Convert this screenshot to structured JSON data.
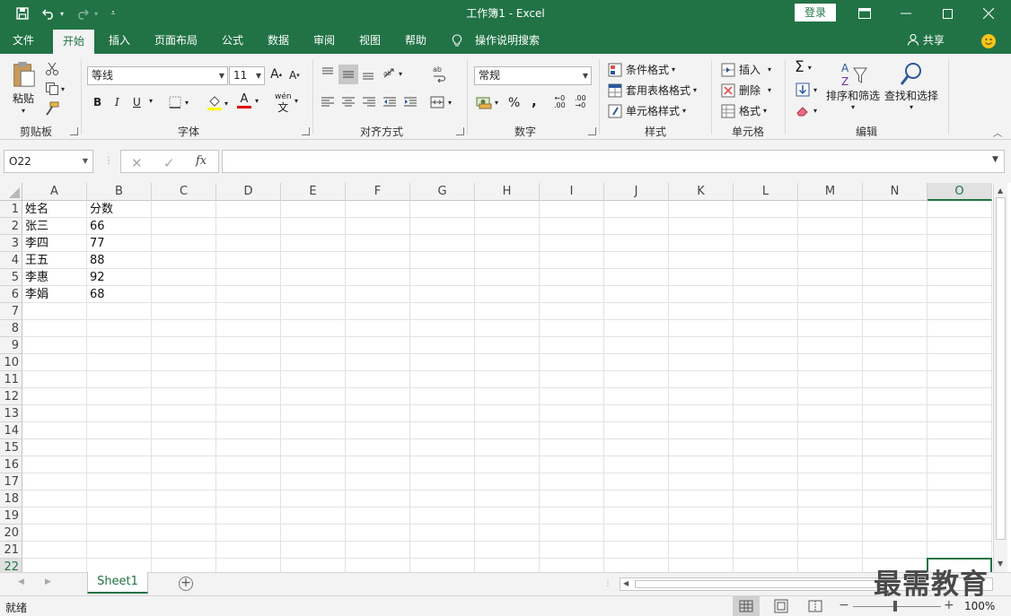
{
  "titlebar": {
    "title": "工作簿1  -  Excel",
    "login": "登录"
  },
  "tabs": [
    {
      "label": "文件",
      "active": false
    },
    {
      "label": "开始",
      "active": true
    },
    {
      "label": "插入",
      "active": false
    },
    {
      "label": "页面布局",
      "active": false
    },
    {
      "label": "公式",
      "active": false
    },
    {
      "label": "数据",
      "active": false
    },
    {
      "label": "审阅",
      "active": false
    },
    {
      "label": "视图",
      "active": false
    },
    {
      "label": "帮助",
      "active": false
    }
  ],
  "tell_me": "操作说明搜索",
  "share": "共享",
  "ribbon": {
    "clipboard": {
      "label": "剪贴板",
      "paste": "粘贴"
    },
    "font": {
      "label": "字体",
      "font_name": "等线",
      "font_size": "11",
      "wen": "wén",
      "bold": "B",
      "italic": "I",
      "underline": "U",
      "grow": "A",
      "shrink": "A",
      "font_color_letter": "A"
    },
    "alignment": {
      "label": "对齐方式"
    },
    "number": {
      "label": "数字",
      "format": "常规",
      "percent": "%",
      "comma": ",",
      "inc_decimal": ".00",
      "dec_decimal": ".00"
    },
    "styles": {
      "label": "样式",
      "conditional": "条件格式",
      "table": "套用表格格式",
      "cell_styles": "单元格样式"
    },
    "cells": {
      "label": "单元格",
      "insert": "插入",
      "delete": "删除",
      "format": "格式"
    },
    "editing": {
      "label": "编辑",
      "sort_filter": "排序和筛选",
      "find_select": "查找和选择",
      "sigma": "Σ"
    }
  },
  "formula_bar": {
    "name_box": "O22",
    "fx": "fx"
  },
  "grid": {
    "columns": [
      "A",
      "B",
      "C",
      "D",
      "E",
      "F",
      "G",
      "H",
      "I",
      "J",
      "K",
      "L",
      "M",
      "N",
      "O"
    ],
    "rows": [
      "1",
      "2",
      "3",
      "4",
      "5",
      "6",
      "7",
      "8",
      "9",
      "10",
      "11",
      "12",
      "13",
      "14",
      "15",
      "16",
      "17",
      "18",
      "19",
      "20",
      "21",
      "22"
    ],
    "cells": [
      [
        "姓名",
        "分数"
      ],
      [
        "张三",
        "66"
      ],
      [
        "李四",
        "77"
      ],
      [
        "王五",
        "88"
      ],
      [
        "李惠",
        "92"
      ],
      [
        "李娟",
        "68"
      ]
    ]
  },
  "sheets": [
    "Sheet1"
  ],
  "status": {
    "ready": "就绪",
    "zoom": "100%",
    "minus": "−",
    "plus": "+"
  },
  "watermark": "最需教育",
  "colors": {
    "brand": "#217346",
    "ribbon_bg": "#f3f3f3"
  }
}
